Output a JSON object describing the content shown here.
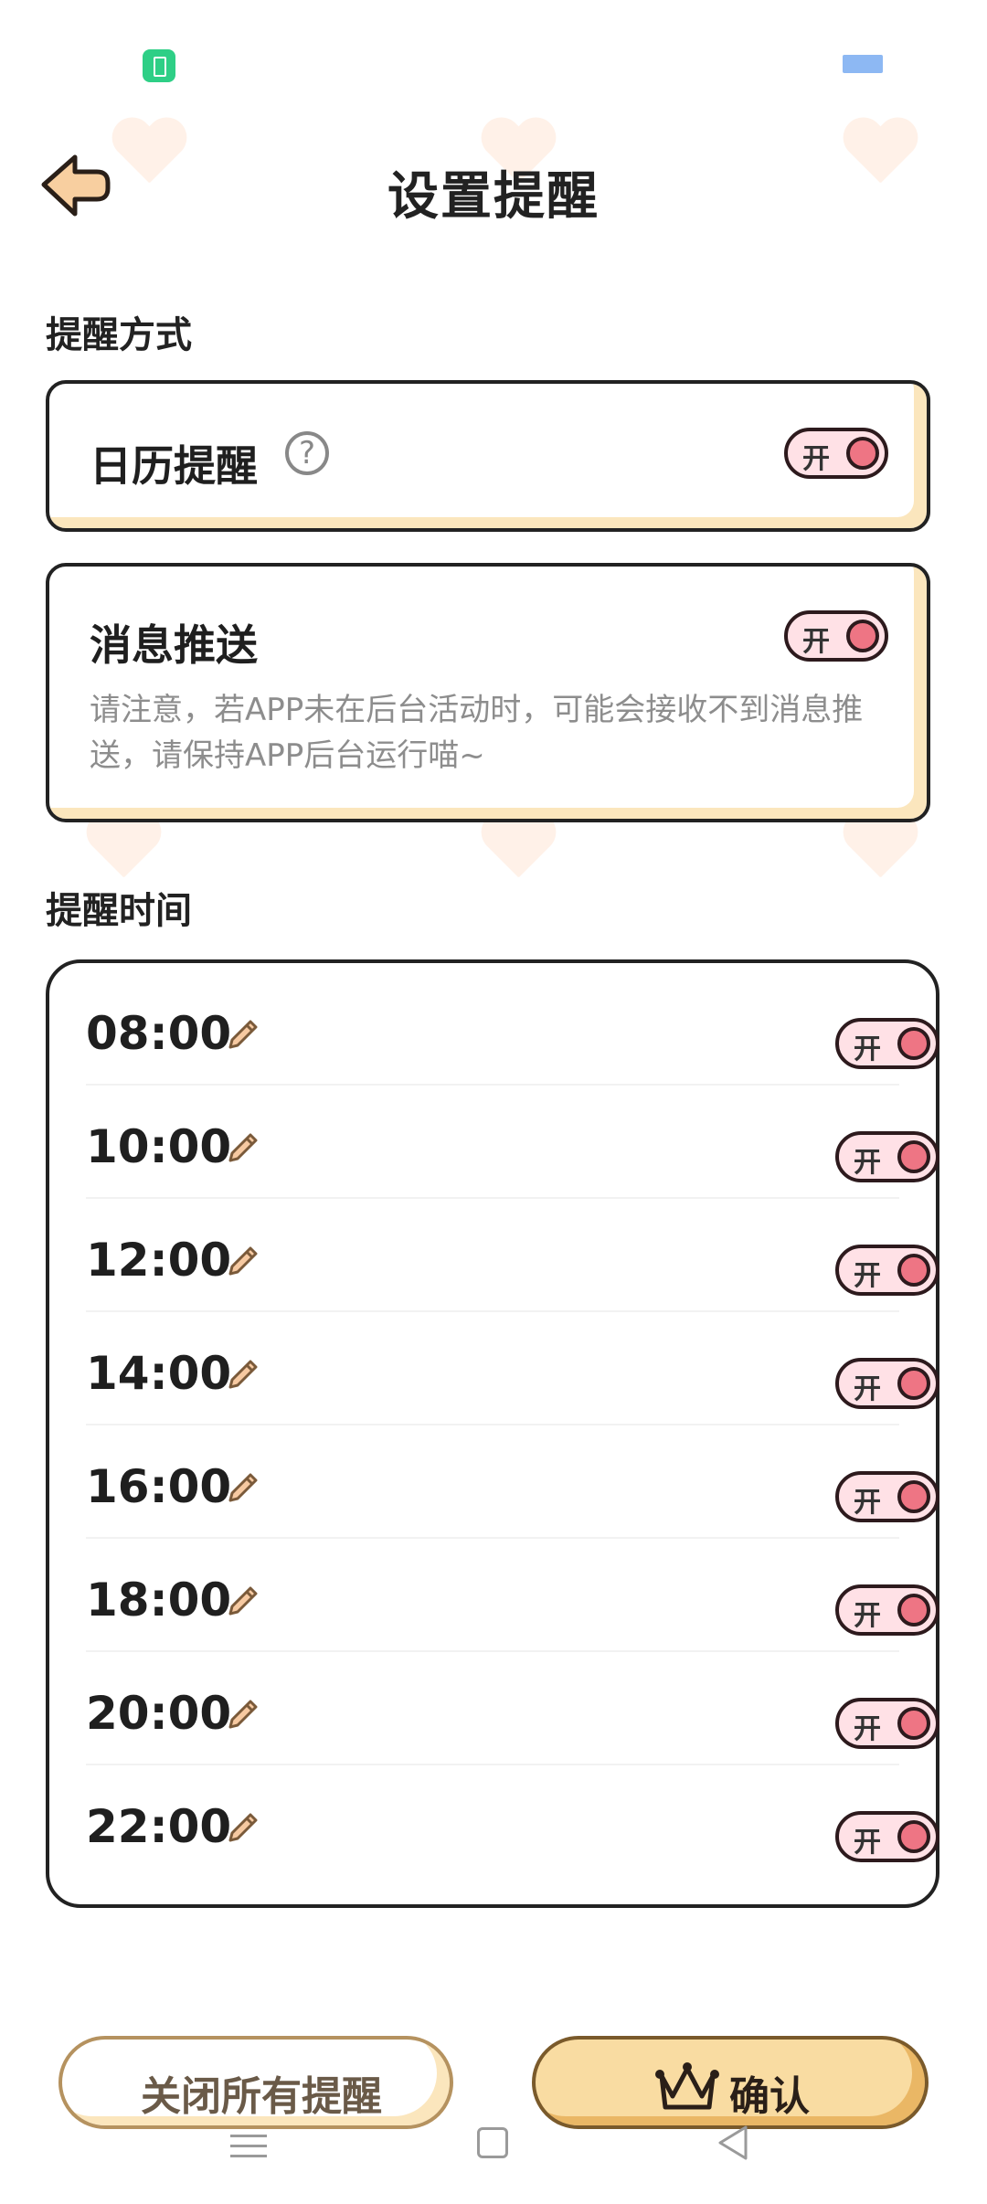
{
  "header": {
    "title": "设置提醒"
  },
  "method_section": {
    "label": "提醒方式",
    "calendar": {
      "title": "日历提醒",
      "help_icon": "question-circle-icon",
      "toggle_label": "开",
      "on": true
    },
    "push": {
      "title": "消息推送",
      "note": "请注意，若APP未在后台活动时，可能会接收不到消息推送，请保持APP后台运行喵~",
      "toggle_label": "开",
      "on": true
    }
  },
  "time_section": {
    "label": "提醒时间",
    "times": [
      {
        "time": "08:00",
        "toggle_label": "开",
        "on": true
      },
      {
        "time": "10:00",
        "toggle_label": "开",
        "on": true
      },
      {
        "time": "12:00",
        "toggle_label": "开",
        "on": true
      },
      {
        "time": "14:00",
        "toggle_label": "开",
        "on": true
      },
      {
        "time": "16:00",
        "toggle_label": "开",
        "on": true
      },
      {
        "time": "18:00",
        "toggle_label": "开",
        "on": true
      },
      {
        "time": "20:00",
        "toggle_label": "开",
        "on": true
      },
      {
        "time": "22:00",
        "toggle_label": "开",
        "on": true
      }
    ]
  },
  "footer": {
    "close_all_label": "关闭所有提醒",
    "confirm_label": "确认"
  },
  "colors": {
    "accent": "#f9dca2",
    "toggle_on": "#ee7584",
    "toggle_bg": "#ffe1e6",
    "border": "#222222"
  },
  "icons": {
    "back": "back-arrow-icon",
    "edit": "pencil-icon",
    "confirm": "crown-icon",
    "battery": "battery-icon",
    "nav": [
      "menu-icon",
      "home-icon",
      "back-triangle-icon"
    ]
  }
}
